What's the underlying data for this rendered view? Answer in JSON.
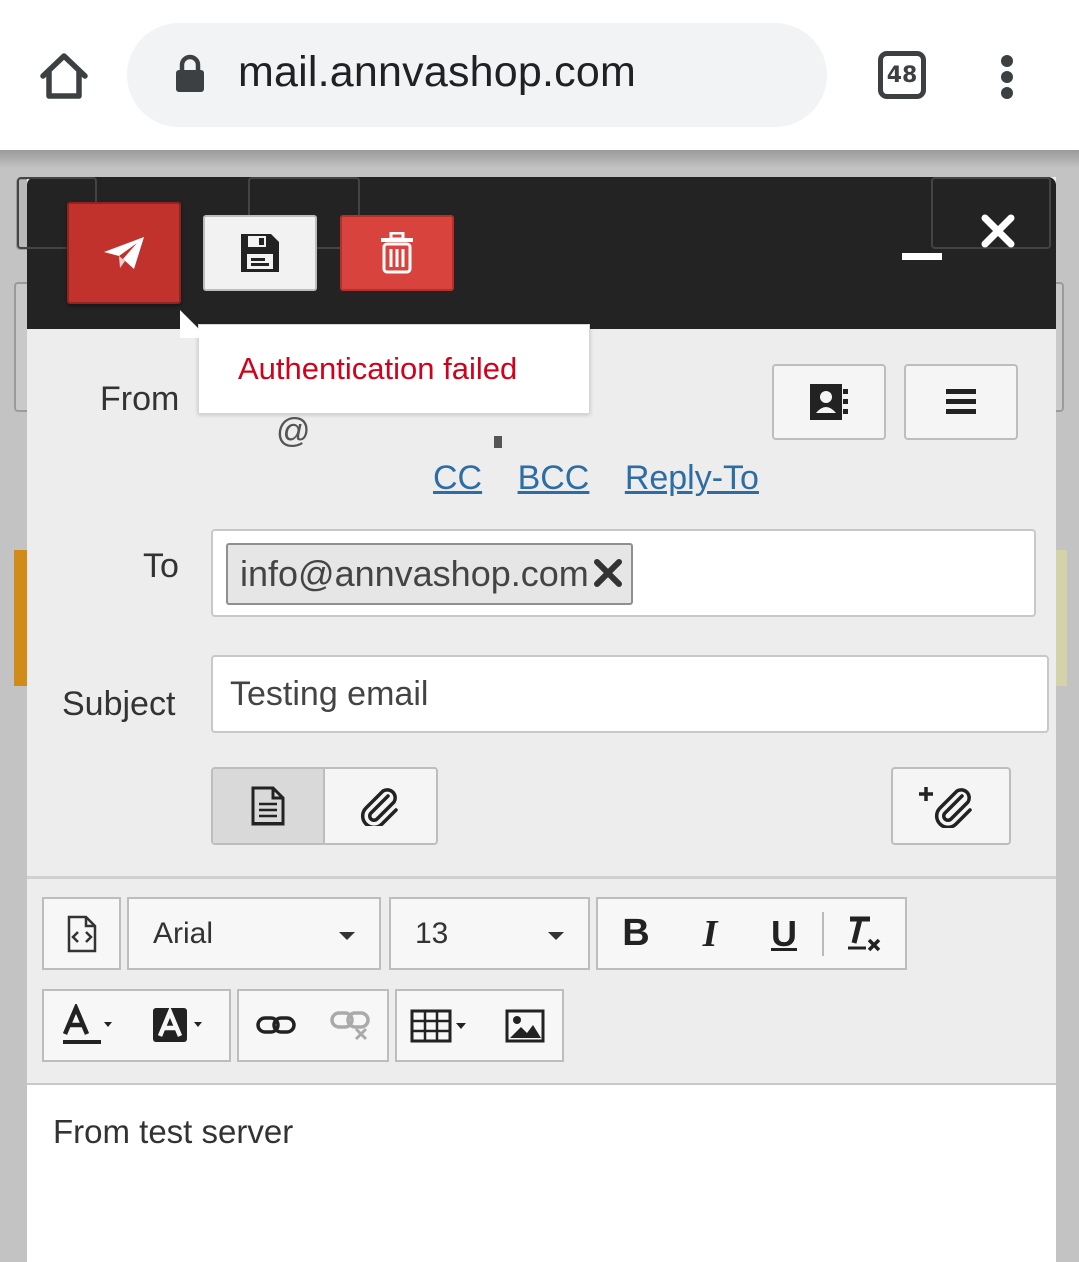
{
  "browser": {
    "url": "mail.annvashop.com",
    "tab_count": "48"
  },
  "toolbar": {
    "send_icon": "paper-plane-icon",
    "save_icon": "floppy-disk-icon",
    "delete_icon": "trash-icon",
    "send_color": "#c0322b",
    "delete_color": "#d9433d"
  },
  "tooltip": {
    "message": "Authentication failed"
  },
  "compose": {
    "from_label": "From",
    "to_label": "To",
    "subject_label": "Subject",
    "links": {
      "cc": "CC",
      "bcc": "BCC",
      "reply_to": "Reply-To"
    },
    "recipients": [
      "info@annvashop.com"
    ],
    "subject": "Testing email"
  },
  "editor": {
    "font_family": "Arial",
    "font_size": "13",
    "bold_label": "B",
    "italic_label": "I",
    "underline_label": "U",
    "body_text": "From test server"
  }
}
